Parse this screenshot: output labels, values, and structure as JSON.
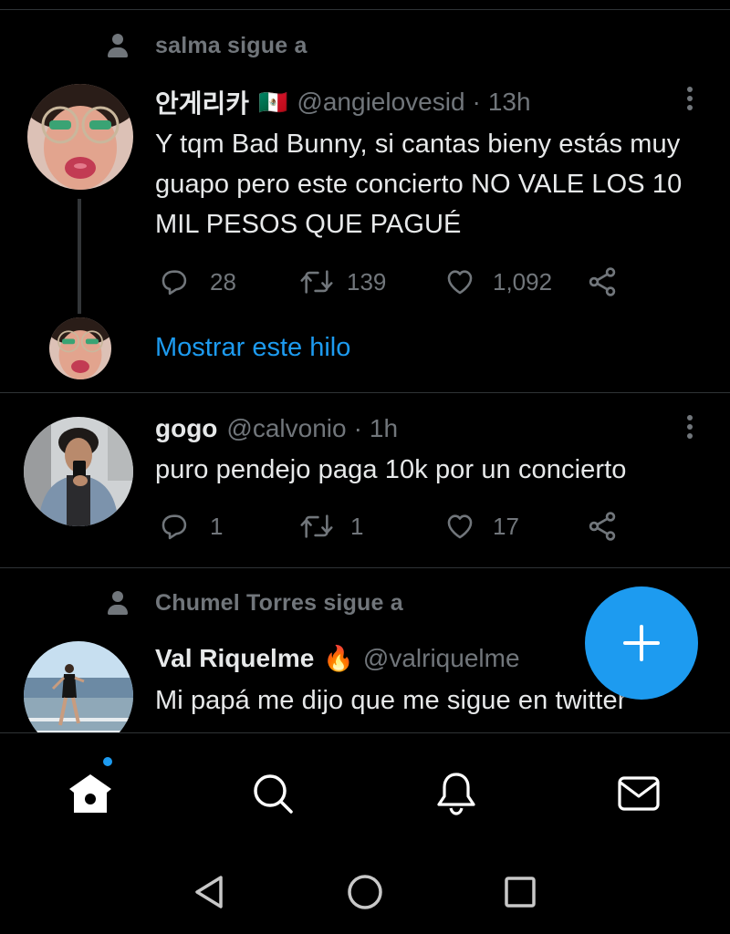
{
  "tweets": [
    {
      "context": "salma sigue a",
      "name": "안게리카",
      "flag_emoji": "🇲🇽",
      "handle": "@angielovesid",
      "separator": "·",
      "time": "13h",
      "text": "Y tqm Bad Bunny, si cantas bieny estás muy guapo pero este concierto NO VALE LOS 10 MIL PESOS QUE PAGUÉ",
      "replies": "28",
      "retweets": "139",
      "likes": "1,092",
      "show_thread": "Mostrar este hilo"
    },
    {
      "name": "gogo",
      "handle": "@calvonio",
      "separator": "·",
      "time": "1h",
      "text": "puro pendejo paga 10k por un concierto",
      "replies": "1",
      "retweets": "1",
      "likes": "17"
    },
    {
      "context": "Chumel Torres sigue a",
      "name": "Val Riquelme",
      "name_emoji": "🔥",
      "handle": "@valriquelme",
      "text": "Mi papá me dijo que me sigue en twitter"
    }
  ],
  "icons": {
    "context": "person-icon",
    "reply": "reply-icon",
    "retweet": "retweet-icon",
    "like": "heart-icon",
    "share": "share-icon",
    "more": "more-vertical-icon",
    "compose": "plus-icon",
    "home": "home-icon",
    "search": "search-icon",
    "notifications": "bell-icon",
    "messages": "mail-icon",
    "back": "back-triangle-icon",
    "home_system": "circle-home-icon",
    "recents": "square-recents-icon"
  },
  "colors": {
    "background": "#000000",
    "primary_text": "#e7e9ea",
    "secondary_text": "#71767b",
    "accent": "#1d9bf0"
  }
}
